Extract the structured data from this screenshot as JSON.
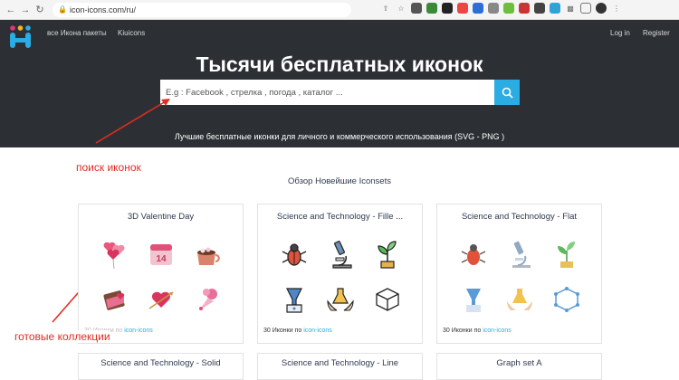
{
  "browser": {
    "url": "icon-icons.com/ru/"
  },
  "header": {
    "nav_packs": "все Икона пакеты",
    "nav_kiuicons": "Kiuicons",
    "login": "Log in",
    "register": "Register",
    "title": "Тысячи бесплатных иконок",
    "search_placeholder": "E.g : Facebook , стрелка , погода , каталог ...",
    "subtitle": "Лучшие бесплатные иконки для личного и коммерческого использования (SVG - PNG )"
  },
  "annotations": {
    "search_label": "поиск иконок",
    "collections_label": "готовые коллекции"
  },
  "section": {
    "title": "Обзор Новейшие Iconsets"
  },
  "cards": [
    {
      "title": "3D Valentine Day",
      "count": "30 Иконки по",
      "link": "icon-icons"
    },
    {
      "title": "Science and Technology - Fille ...",
      "count": "30 Иконки по",
      "link": "icon-icons"
    },
    {
      "title": "Science and Technology - Flat",
      "count": "30 Иконки по",
      "link": "icon-icons"
    }
  ],
  "cards_row2": [
    {
      "title": "Science and Technology - Solid"
    },
    {
      "title": "Science and Technology - Line"
    },
    {
      "title": "Graph set A"
    }
  ],
  "colors": {
    "header_bg": "#2c3035",
    "accent": "#2bace2",
    "annotation": "#e02b20"
  }
}
